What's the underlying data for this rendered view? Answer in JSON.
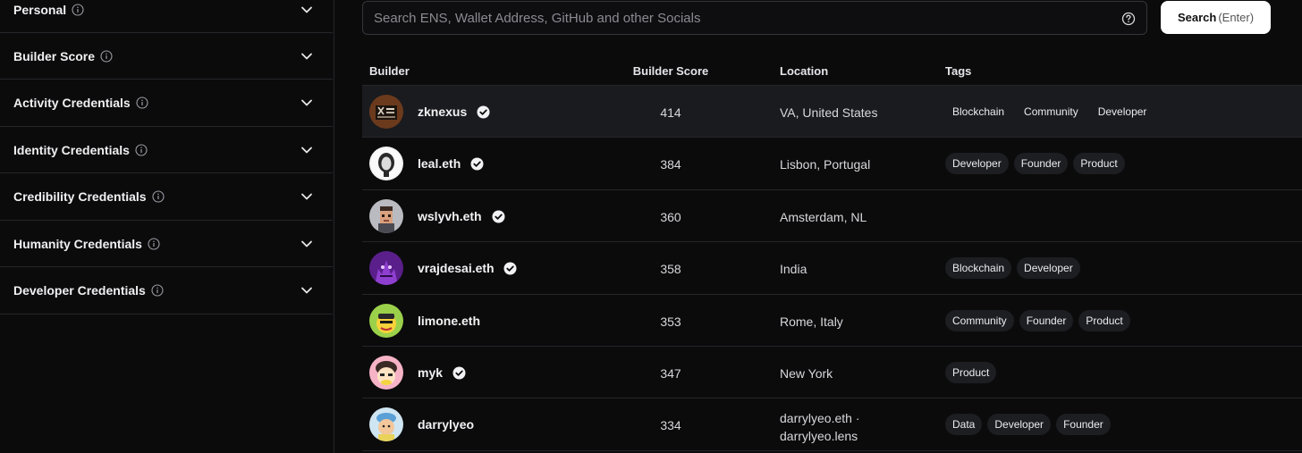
{
  "sidebar": {
    "filters": [
      {
        "label": "Personal",
        "icon": "info-icon"
      },
      {
        "label": "Builder Score",
        "icon": "info-icon"
      },
      {
        "label": "Activity Credentials",
        "icon": "info-icon"
      },
      {
        "label": "Identity Credentials",
        "icon": "info-icon"
      },
      {
        "label": "Credibility Credentials",
        "icon": "info-icon"
      },
      {
        "label": "Humanity Credentials",
        "icon": "info-icon"
      },
      {
        "label": "Developer Credentials",
        "icon": "info-icon"
      }
    ]
  },
  "search": {
    "placeholder": "Search ENS, Wallet Address, GitHub and other Socials",
    "value": "",
    "button_label": "Search",
    "button_hint": "(Enter)"
  },
  "table": {
    "headers": {
      "builder": "Builder",
      "score": "Builder Score",
      "location": "Location",
      "tags": "Tags"
    },
    "rows": [
      {
        "name": "zknexus",
        "verified": true,
        "score": "414",
        "location": "VA, United States",
        "location2": "",
        "tags": [
          "Blockchain",
          "Community",
          "Developer"
        ]
      },
      {
        "name": "leal.eth",
        "verified": true,
        "score": "384",
        "location": "Lisbon, Portugal",
        "location2": "",
        "tags": [
          "Developer",
          "Founder",
          "Product"
        ]
      },
      {
        "name": "wslyvh.eth",
        "verified": true,
        "score": "360",
        "location": "Amsterdam, NL",
        "location2": "",
        "tags": []
      },
      {
        "name": "vrajdesai.eth",
        "verified": true,
        "score": "358",
        "location": "India",
        "location2": "",
        "tags": [
          "Blockchain",
          "Developer"
        ]
      },
      {
        "name": "limone.eth",
        "verified": false,
        "score": "353",
        "location": "Rome, Italy",
        "location2": "",
        "tags": [
          "Community",
          "Founder",
          "Product"
        ]
      },
      {
        "name": "myk",
        "verified": true,
        "score": "347",
        "location": "New York",
        "location2": "",
        "tags": [
          "Product"
        ]
      },
      {
        "name": "darrylyeo",
        "verified": false,
        "score": "334",
        "location": "darrylyeo.eth ·",
        "location2": "darrylyeo.lens",
        "tags": [
          "Data",
          "Developer",
          "Founder"
        ]
      }
    ]
  },
  "colors": {
    "background": "#0b0b0c",
    "border": "#26262a",
    "highlight_row": "#1a1b1e",
    "button_bg": "#ffffff"
  }
}
